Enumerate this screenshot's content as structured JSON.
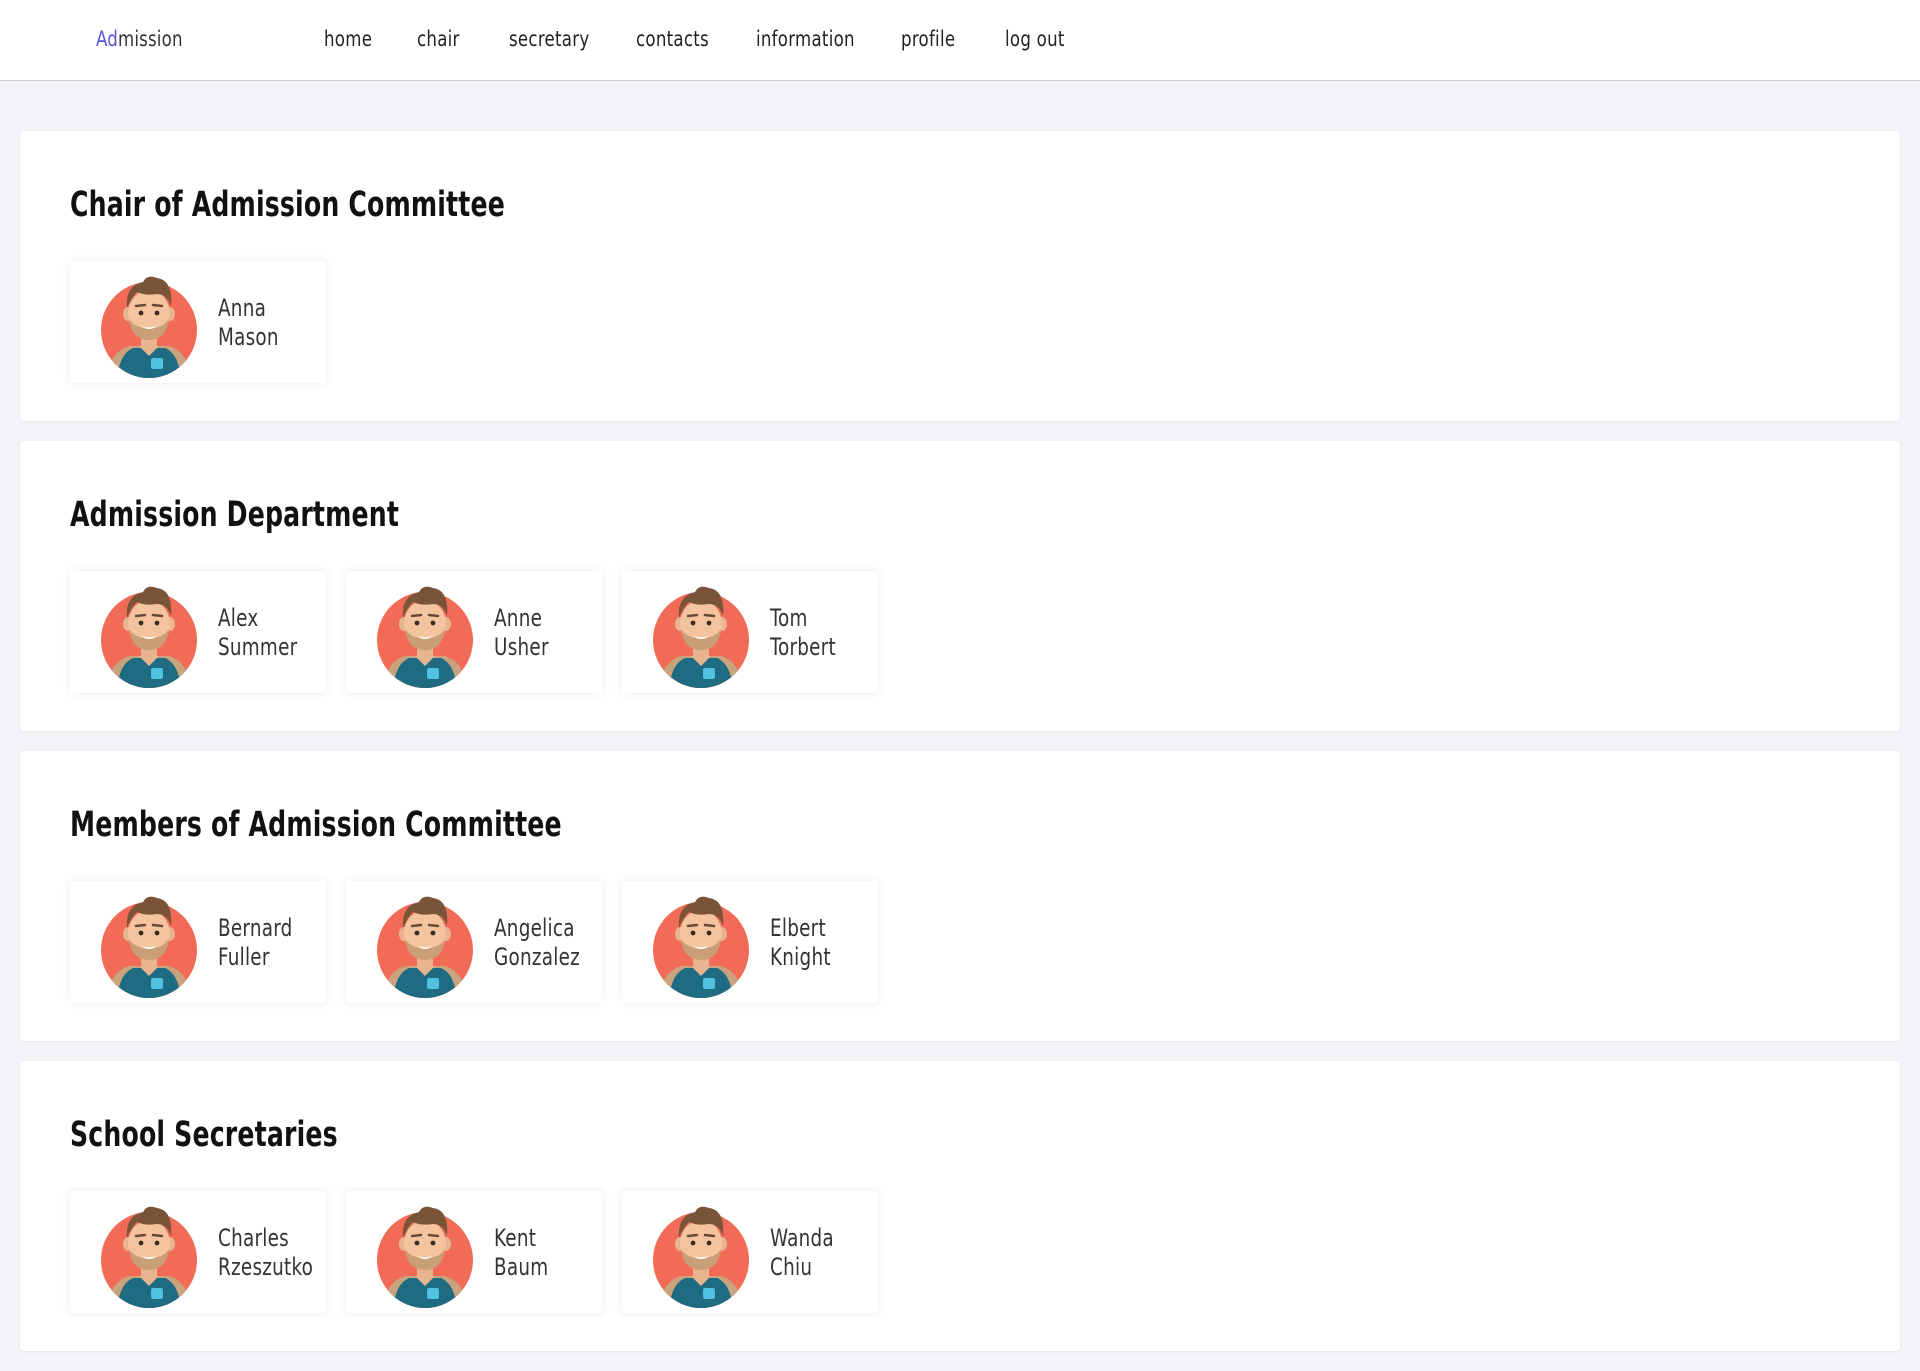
{
  "brand": {
    "accent": "Ad",
    "rest": "mission"
  },
  "nav": [
    {
      "label": "home"
    },
    {
      "label": "chair"
    },
    {
      "label": "secretary"
    },
    {
      "label": "contacts"
    },
    {
      "label": "information"
    },
    {
      "label": "profile"
    },
    {
      "label": "log out"
    }
  ],
  "colors": {
    "brand_accent": "#5b52d6",
    "page_background": "#f2f4f7",
    "avatar_circle": "#f26b56",
    "avatar_shirt": "#1f6b82"
  },
  "sections": [
    {
      "title": "Chair of Admission Committee",
      "people": [
        {
          "first": "Anna",
          "last": "Mason",
          "avatar": "male-avatar-icon"
        }
      ]
    },
    {
      "title": "Admission Department",
      "people": [
        {
          "first": "Alex",
          "last": "Summer",
          "avatar": "male-avatar-icon"
        },
        {
          "first": "Anne",
          "last": "Usher",
          "avatar": "male-avatar-icon"
        },
        {
          "first": "Tom",
          "last": "Torbert",
          "avatar": "male-avatar-icon"
        }
      ]
    },
    {
      "title": "Members of Admission Committee",
      "people": [
        {
          "first": "Bernard",
          "last": "Fuller",
          "avatar": "male-avatar-icon"
        },
        {
          "first": "Angelica",
          "last": "Gonzalez",
          "avatar": "male-avatar-icon"
        },
        {
          "first": "Elbert",
          "last": "Knight",
          "avatar": "male-avatar-icon"
        }
      ]
    },
    {
      "title": "School Secretaries",
      "people": [
        {
          "first": "Charles",
          "last": "Rzeszutko",
          "avatar": "male-avatar-icon"
        },
        {
          "first": "Kent",
          "last": "Baum",
          "avatar": "male-avatar-icon"
        },
        {
          "first": "Wanda",
          "last": "Chiu",
          "avatar": "male-avatar-icon"
        }
      ]
    }
  ]
}
